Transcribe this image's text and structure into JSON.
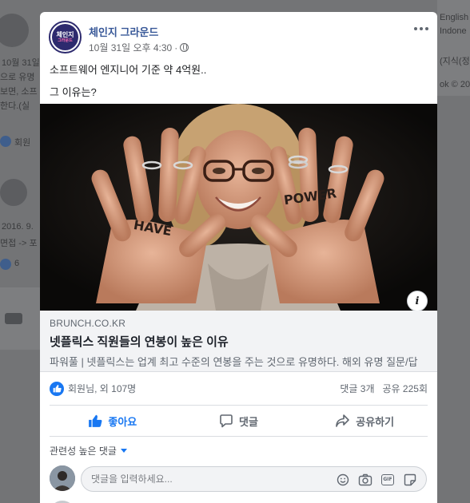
{
  "background": {
    "left_texts": [
      "10월 31일",
      "으로 유명",
      "보면, 소프",
      "한다.(실",
      "회원",
      "2016. 9.",
      "면접 -> 포",
      "6"
    ],
    "right_texts": [
      "English",
      "Indone",
      "(지식(정",
      "ok © 20"
    ]
  },
  "post": {
    "page_name": "체인지 그라운드",
    "page_logo_line1": "체인지",
    "page_logo_line2": "그라운드",
    "timestamp": "10월 31일 오후 4:30",
    "meta_separator": "·",
    "audience_icon": "globe-icon",
    "more_icon": "more-options-icon",
    "text_line1": "소프트웨어 엔지니어 기준 약 4억원..",
    "text_line2": "그 이유는?"
  },
  "link": {
    "image_alt": "Woman smiling with HAVE and POWER written on her palms",
    "hand_left_text": "HAVE",
    "hand_right_text": "POWER",
    "info_label": "i",
    "domain": "BRUNCH.CO.KR",
    "title": "넷플릭스 직원들의 연봉이 높은 이유",
    "description": "파워풀 | 넷플릭스는 업계 최고 수준의 연봉을 주는 것으로 유명하다. 해외 유명 질문/답"
  },
  "stats": {
    "reactions": "회원님, 외 107명",
    "comments": "댓글 3개",
    "shares": "공유 225회"
  },
  "actions": {
    "like": "좋아요",
    "comment": "댓글",
    "share": "공유하기"
  },
  "comments": {
    "filter_label": "관련성 높은 댓글",
    "placeholder": "댓글을 입력하세요..."
  },
  "colors": {
    "brand_blue": "#1877f2",
    "page_name": "#385898",
    "logo_navy": "#2d2a6e"
  }
}
